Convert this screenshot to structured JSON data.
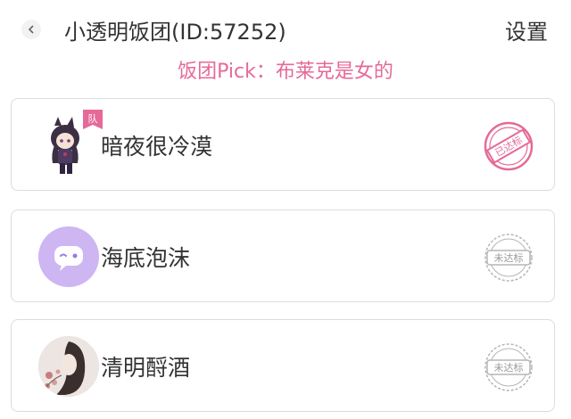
{
  "header": {
    "title": "小透明饭团(ID:57252)",
    "settings_label": "设置",
    "back_icon": "back-icon"
  },
  "pick": {
    "text": "饭团Pick：布莱克是女的"
  },
  "members": [
    {
      "name": "暗夜很冷漠",
      "badge": "队",
      "stamp": "已达标",
      "stamp_color": "#e56a98"
    },
    {
      "name": "海底泡沫",
      "stamp": "未达标",
      "stamp_color": "#b5b5b5"
    },
    {
      "name": "清明酹酒",
      "stamp": "未达标",
      "stamp_color": "#b5b5b5"
    }
  ],
  "colors": {
    "accent": "#e56a98",
    "muted": "#b5b5b5",
    "avatar_purple": "#cdb6f2"
  }
}
